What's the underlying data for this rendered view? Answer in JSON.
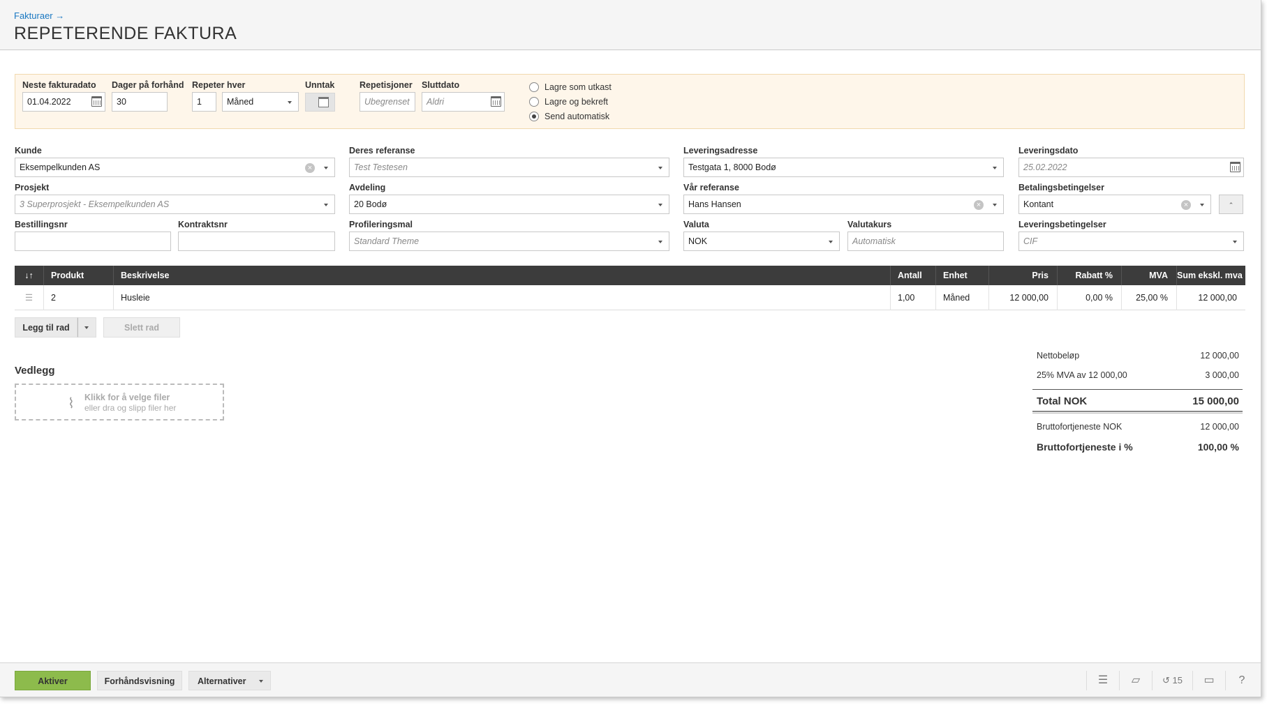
{
  "header": {
    "breadcrumb": "Fakturaer →",
    "title": "REPETERENDE FAKTURA"
  },
  "schedule": {
    "next_date_label": "Neste fakturadato",
    "next_date": "01.04.2022",
    "days_label": "Dager på forhånd",
    "days": "30",
    "repeat_label": "Repeter hver",
    "repeat_n": "1",
    "repeat_unit": "Måned",
    "exceptions_label": "Unntak",
    "repetitions_label": "Repetisjoner",
    "repetitions_placeholder": "Ubegrenset",
    "end_label": "Sluttdato",
    "end_placeholder": "Aldri",
    "radio_options": [
      "Lagre som utkast",
      "Lagre og bekreft",
      "Send automatisk"
    ],
    "selected_radio": "Send automatisk"
  },
  "form": {
    "kunde_label": "Kunde",
    "kunde": "Eksempelkunden AS",
    "deres_ref_label": "Deres referanse",
    "deres_ref_placeholder": "Test Testesen",
    "levadr_label": "Leveringsadresse",
    "levadr": "Testgata 1, 8000 Bodø",
    "levdato_label": "Leveringsdato",
    "levdato_placeholder": "25.02.2022",
    "prosjekt_label": "Prosjekt",
    "prosjekt_placeholder": "3 Superprosjekt - Eksempelkunden AS",
    "avdeling_label": "Avdeling",
    "avdeling": "20 Bodø",
    "var_ref_label": "Vår referanse",
    "var_ref": "Hans Hansen",
    "betaling_label": "Betalingsbetingelser",
    "betaling": "Kontant",
    "bestilling_label": "Bestillingsnr",
    "kontrakt_label": "Kontraktsnr",
    "profil_label": "Profileringsmal",
    "profil_placeholder": "Standard Theme",
    "valuta_label": "Valuta",
    "valuta": "NOK",
    "valutakurs_label": "Valutakurs",
    "valutakurs_placeholder": "Automatisk",
    "levbet_label": "Leveringsbetingelser",
    "levbet_placeholder": "CIF"
  },
  "table": {
    "sort_icon": "↓↑",
    "headers": [
      "Produkt",
      "Beskrivelse",
      "Antall",
      "Enhet",
      "Pris",
      "Rabatt %",
      "MVA",
      "Sum ekskl. mva"
    ],
    "rows": [
      {
        "produkt": "2",
        "beskrivelse": "Husleie",
        "antall": "1,00",
        "enhet": "Måned",
        "pris": "12 000,00",
        "rabatt": "0,00 %",
        "mva": "25,00 %",
        "sum": "12 000,00"
      }
    ]
  },
  "row_actions": {
    "add": "Legg til rad",
    "delete": "Slett rad"
  },
  "attachments": {
    "title": "Vedlegg",
    "line1": "Klikk for å velge filer",
    "line2": "eller dra og slipp filer her"
  },
  "summary": {
    "netto_label": "Nettobeløp",
    "netto": "12 000,00",
    "mva_label": "25% MVA av 12 000,00",
    "mva": "3 000,00",
    "total_label": "Total NOK",
    "total": "15 000,00",
    "brutto_label": "Bruttofortjeneste NOK",
    "brutto": "12 000,00",
    "brutto_pct_label": "Bruttofortjeneste i %",
    "brutto_pct": "100,00 %"
  },
  "footer": {
    "activate": "Aktiver",
    "preview": "Forhåndsvisning",
    "alternatives": "Alternativer",
    "history_count": "15"
  },
  "colors": {
    "accent": "#8dbb4c",
    "link": "#1a78c2",
    "header_bg": "#3c3c3c",
    "settings_bg": "#fef6ea"
  }
}
